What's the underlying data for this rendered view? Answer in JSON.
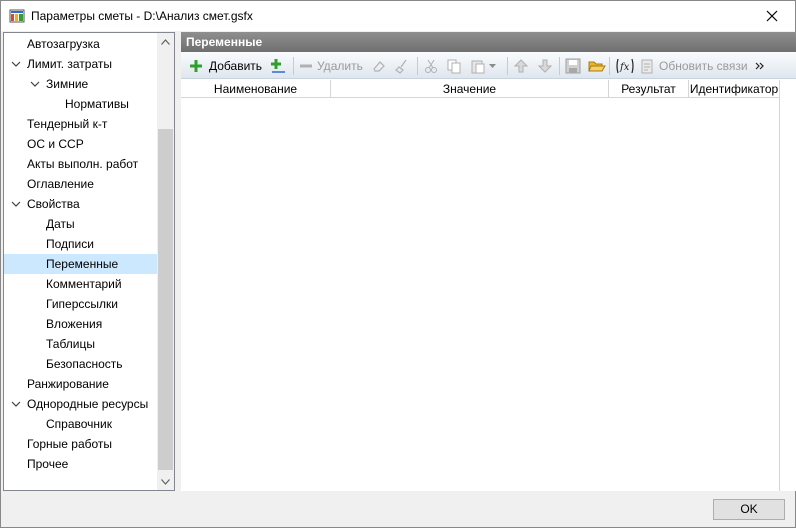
{
  "window": {
    "title": "Параметры сметы - D:\\Анализ смет.gsfx",
    "accent_color": "#cce8ff"
  },
  "tree": {
    "items": [
      {
        "label": "Автозагрузка",
        "level": 0,
        "expandable": false
      },
      {
        "label": "Лимит. затраты",
        "level": 0,
        "expandable": true,
        "expanded": true
      },
      {
        "label": "Зимние",
        "level": 1,
        "expandable": true,
        "expanded": true
      },
      {
        "label": "Нормативы",
        "level": 2,
        "expandable": false
      },
      {
        "label": "Тендерный к-т",
        "level": 0,
        "expandable": false
      },
      {
        "label": "ОС и ССР",
        "level": 0,
        "expandable": false
      },
      {
        "label": "Акты выполн. работ",
        "level": 0,
        "expandable": false
      },
      {
        "label": "Оглавление",
        "level": 0,
        "expandable": false
      },
      {
        "label": "Свойства",
        "level": 0,
        "expandable": true,
        "expanded": true
      },
      {
        "label": "Даты",
        "level": 1,
        "expandable": false
      },
      {
        "label": "Подписи",
        "level": 1,
        "expandable": false
      },
      {
        "label": "Переменные",
        "level": 1,
        "expandable": false,
        "selected": true
      },
      {
        "label": "Комментарий",
        "level": 1,
        "expandable": false
      },
      {
        "label": "Гиперссылки",
        "level": 1,
        "expandable": false
      },
      {
        "label": "Вложения",
        "level": 1,
        "expandable": false
      },
      {
        "label": "Таблицы",
        "level": 1,
        "expandable": false
      },
      {
        "label": "Безопасность",
        "level": 1,
        "expandable": false
      },
      {
        "label": "Ранжирование",
        "level": 0,
        "expandable": false
      },
      {
        "label": "Однородные ресурсы",
        "level": 0,
        "expandable": true,
        "expanded": true
      },
      {
        "label": "Справочник",
        "level": 1,
        "expandable": false
      },
      {
        "label": "Горные работы",
        "level": 0,
        "expandable": false
      },
      {
        "label": "Прочее",
        "level": 0,
        "expandable": false
      }
    ]
  },
  "panel": {
    "title": "Переменные",
    "toolbar": {
      "add_label": "Добавить",
      "delete_label": "Удалить",
      "refresh_links_label": "Обновить связи"
    },
    "columns": [
      "Наименование",
      "Значение",
      "Результат",
      "Идентификатор"
    ]
  },
  "footer": {
    "ok_label": "OK"
  }
}
